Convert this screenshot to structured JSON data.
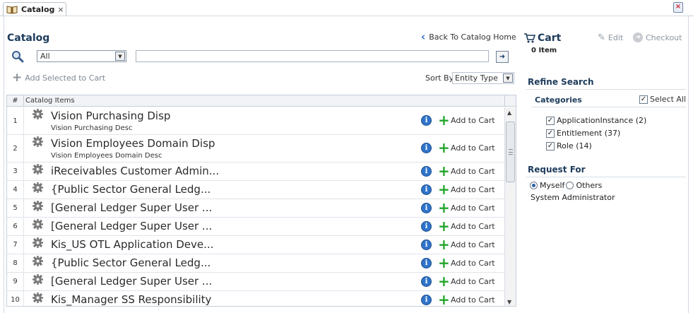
{
  "tab": {
    "label": "Catalog",
    "close": "×"
  },
  "catalog": {
    "title": "Catalog",
    "back_link": "Back To Catalog Home",
    "search": {
      "scope_selected": "All",
      "query": "",
      "go_label": "➜"
    },
    "add_selected": "Add Selected to Cart",
    "sort": {
      "label": "Sort By",
      "selected": "Entity Type"
    },
    "table": {
      "col_num": "#",
      "col_items": "Catalog Items",
      "add_to_cart": "Add to Cart",
      "rows": [
        {
          "num": "1",
          "name": "Vision Purchasing Disp",
          "desc": "Vision Purchasing Desc"
        },
        {
          "num": "2",
          "name": "Vision Employees Domain Disp",
          "desc": "Vision Employees Domain Desc"
        },
        {
          "num": "3",
          "name": "iReceivables Customer Admin...",
          "desc": ""
        },
        {
          "num": "4",
          "name": "{Public Sector General Ledg...",
          "desc": ""
        },
        {
          "num": "5",
          "name": "[General Ledger Super User ...",
          "desc": ""
        },
        {
          "num": "6",
          "name": "[General Ledger Super User ...",
          "desc": ""
        },
        {
          "num": "7",
          "name": "Kis_US OTL Application Deve...",
          "desc": ""
        },
        {
          "num": "8",
          "name": "{Public Sector General Ledg...",
          "desc": ""
        },
        {
          "num": "9",
          "name": "[General Ledger Super User ...",
          "desc": ""
        },
        {
          "num": "10",
          "name": "Kis_Manager SS Responsibility",
          "desc": ""
        }
      ]
    }
  },
  "cart": {
    "title": "Cart",
    "count": "0 Item",
    "edit": "Edit",
    "checkout": "Checkout"
  },
  "refine": {
    "title": "Refine Search",
    "categories_label": "Categories",
    "select_all": "Select All",
    "items": [
      {
        "label": "ApplicationInstance (2)",
        "checked": true
      },
      {
        "label": "Entitlement (37)",
        "checked": true
      },
      {
        "label": "Role (14)",
        "checked": true
      }
    ]
  },
  "request_for": {
    "title": "Request For",
    "myself": "Myself",
    "others": "Others",
    "selected": "Myself",
    "user": "System Administrator"
  },
  "colors": {
    "heading": "#1d3b5c",
    "info_blue": "#2f74c9",
    "add_green": "#22a62b"
  }
}
